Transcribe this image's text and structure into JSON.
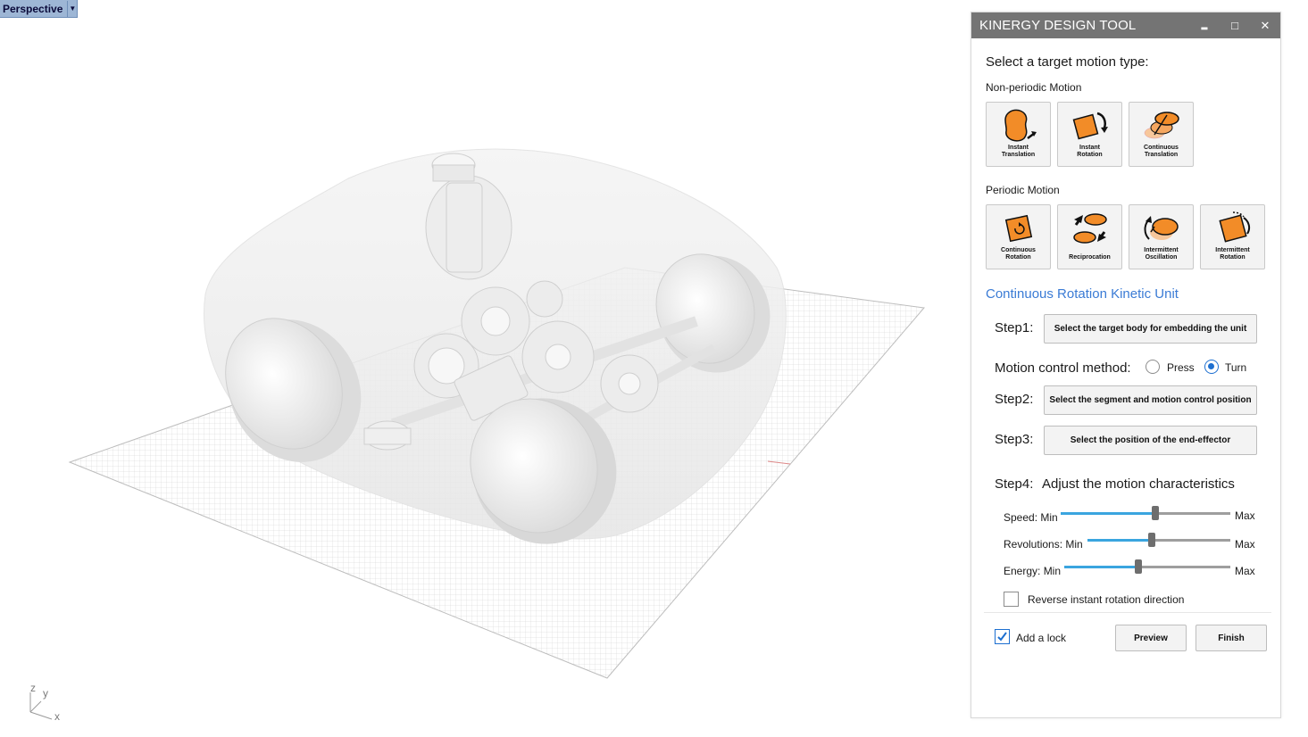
{
  "viewport": {
    "name": "Perspective",
    "dropdown_glyph": "▼",
    "axis": {
      "z": "z",
      "y": "y",
      "x": "x"
    }
  },
  "panel": {
    "title": "KINERGY DESIGN TOOL",
    "window_buttons": {
      "minimize": "▂",
      "maximize": "□",
      "close": "✕"
    },
    "select_heading": "Select a target motion type:",
    "nonperiodic_label": "Non-periodic Motion",
    "nonperiodic": [
      {
        "line1": "Instant",
        "line2": "Translation",
        "icon": "instant-translation-icon"
      },
      {
        "line1": "Instant",
        "line2": "Rotation",
        "icon": "instant-rotation-icon"
      },
      {
        "line1": "Continuous",
        "line2": "Translation",
        "icon": "continuous-translation-icon"
      }
    ],
    "periodic_label": "Periodic Motion",
    "periodic": [
      {
        "line1": "Continuous",
        "line2": "Rotation",
        "icon": "continuous-rotation-icon"
      },
      {
        "line1": "",
        "line2": "Reciprocation",
        "icon": "reciprocation-icon"
      },
      {
        "line1": "Intermittent",
        "line2": "Oscillation",
        "icon": "intermittent-oscillation-icon"
      },
      {
        "line1": "Intermittent",
        "line2": "Rotation",
        "icon": "intermittent-rotation-icon"
      }
    ],
    "unit_title": "Continuous Rotation Kinetic Unit",
    "step1": {
      "label": "Step1:",
      "button": "Select the target body  for embedding the unit"
    },
    "motion_control": {
      "label": "Motion control method:",
      "options": [
        "Press",
        "Turn"
      ],
      "selected": "Turn"
    },
    "step2": {
      "label": "Step2:",
      "button": "Select the segment and motion control position"
    },
    "step3": {
      "label": "Step3:",
      "button": "Select the position of the end-effector"
    },
    "step4": {
      "label": "Step4:",
      "text": "Adjust the motion characteristics"
    },
    "sliders": [
      {
        "label": "Speed: Min",
        "max": "Max",
        "value": 0.56
      },
      {
        "label": "Revolutions: Min",
        "max": "Max",
        "value": 0.45
      },
      {
        "label": "Energy: Min",
        "max": "Max",
        "value": 0.45
      }
    ],
    "reverse_checkbox": {
      "label": "Reverse instant rotation direction",
      "checked": false
    },
    "lock_checkbox": {
      "label": "Add a lock",
      "checked": true
    },
    "preview_button": "Preview",
    "finish_button": "Finish",
    "accent_color": "#3a7bd5",
    "icon_color": "#f28c28"
  }
}
